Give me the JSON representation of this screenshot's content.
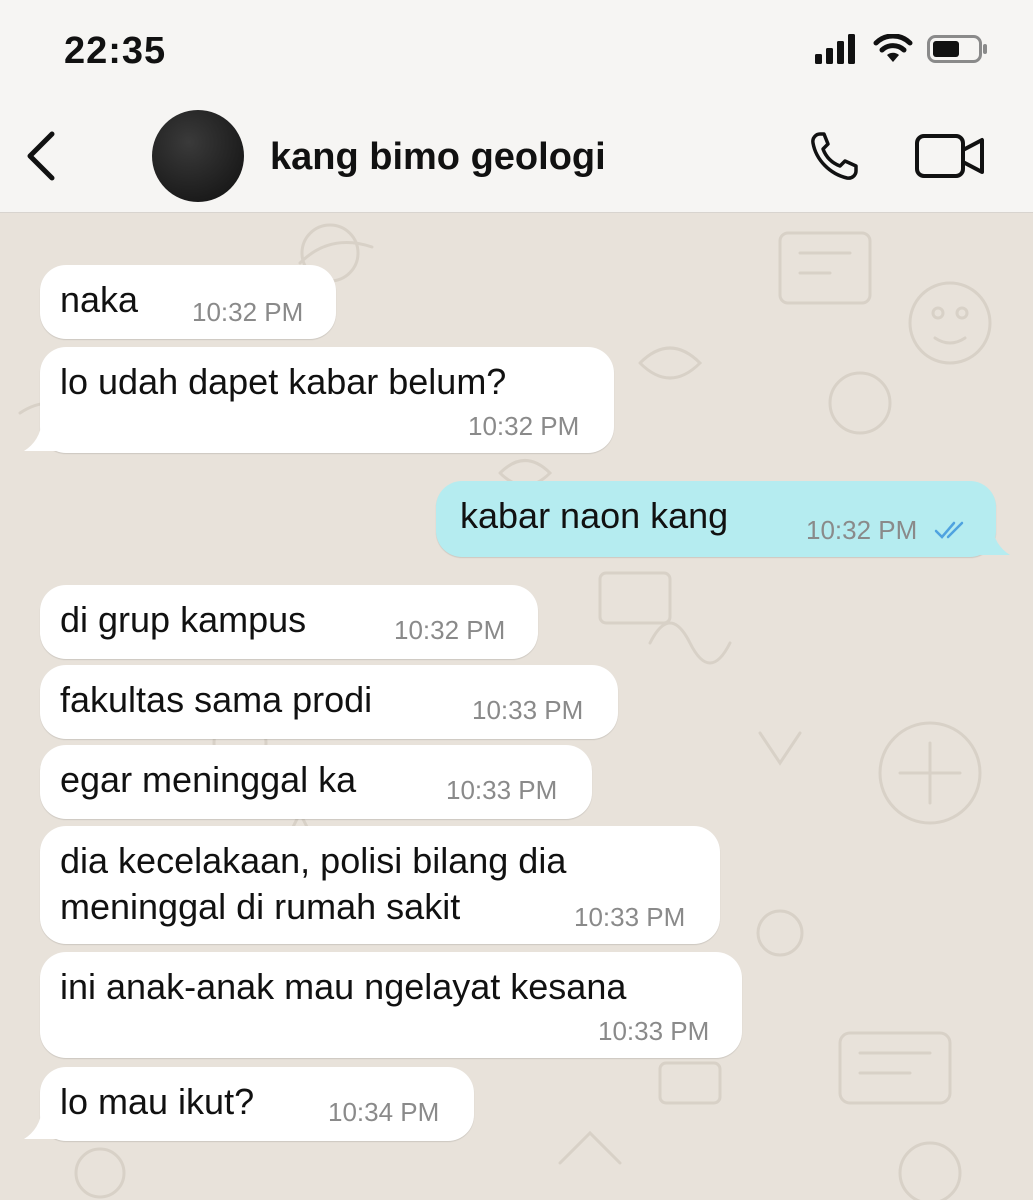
{
  "status_bar": {
    "time": "22:35",
    "icons": [
      "signal-icon",
      "wifi-icon",
      "battery-icon"
    ]
  },
  "header": {
    "contact_name": "kang bimo geologi",
    "icons": [
      "back-icon",
      "phone-icon",
      "video-call-icon"
    ]
  },
  "colors": {
    "incoming_bubble": "#ffffff",
    "outgoing_bubble": "#b5ecf0",
    "chat_background": "#e8e2da",
    "read_ticks": "#4fa3e0"
  },
  "messages": [
    {
      "direction": "in",
      "text": "naka",
      "time": "10:32 PM"
    },
    {
      "direction": "in",
      "text": "lo udah dapet kabar belum?",
      "time": "10:32 PM"
    },
    {
      "direction": "out",
      "text": "kabar naon kang",
      "time": "10:32 PM",
      "status": "read"
    },
    {
      "direction": "in",
      "text": "di grup kampus",
      "time": "10:32 PM"
    },
    {
      "direction": "in",
      "text": "fakultas sama prodi",
      "time": "10:33 PM"
    },
    {
      "direction": "in",
      "text": "egar meninggal ka",
      "time": "10:33 PM"
    },
    {
      "direction": "in",
      "text_lines": [
        "dia kecelakaan, polisi bilang dia",
        "meninggal di rumah sakit"
      ],
      "time": "10:33 PM"
    },
    {
      "direction": "in",
      "text": "ini anak-anak mau ngelayat kesana",
      "time": "10:33 PM"
    },
    {
      "direction": "in",
      "text": "lo mau ikut?",
      "time": "10:34 PM"
    }
  ]
}
